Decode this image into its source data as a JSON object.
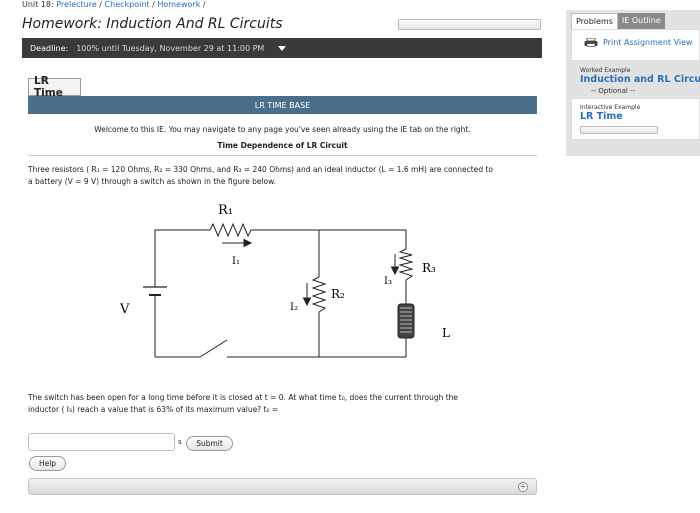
{
  "breadcrumb": {
    "unit": "Unit 18:",
    "items": [
      "Prelecture",
      "Checkpoint",
      "Homework"
    ]
  },
  "header": {
    "title": "Homework: Induction And RL Circuits",
    "deadline_label": "Deadline:",
    "deadline_value": "100% until Tuesday, November 29 at 11:00 PM"
  },
  "sidebar": {
    "tabs": [
      "Problems",
      "IE Outline"
    ],
    "print_label": "Print Assignment View",
    "worked_small": "Worked Example",
    "worked_title": "Induction and RL Circuits",
    "worked_optional": "-- Optional --",
    "interactive_small": "Interactive Example",
    "interactive_title": "LR Time"
  },
  "main": {
    "tab_label": "LR Time",
    "section_title": "LR TIME BASE",
    "welcome": "Welcome to this IE. You may navigate to any page you've seen already using the IE tab on the right.",
    "subhead": "Time Dependence of LR Circuit",
    "problem_line1": "Three resistors ( R₁ = 120 Ohms, R₂ = 330 Ohms, and R₃ = 240 Ohms) and an ideal inductor (L = 1.6 mH) are connected to",
    "problem_line2": "a battery (V = 9 V) through a switch as shown in the figure below.",
    "question_line1": "The switch has been open for a long time before it is closed at t = 0. At what time t₀, does the current through the",
    "question_line2": "inductor ( I₃) reach a value that is 63% of its maximum value? t₀ =",
    "answer_value": "",
    "unit_label": "s",
    "submit_label": "Submit",
    "help_label": "Help",
    "expand_symbol": "+"
  },
  "circuit": {
    "R1": "R₁",
    "R2": "R₂",
    "R3": "R₃",
    "I1": "I₁",
    "I2": "I₂",
    "I3": "I₃",
    "V": "V",
    "L": "L"
  }
}
